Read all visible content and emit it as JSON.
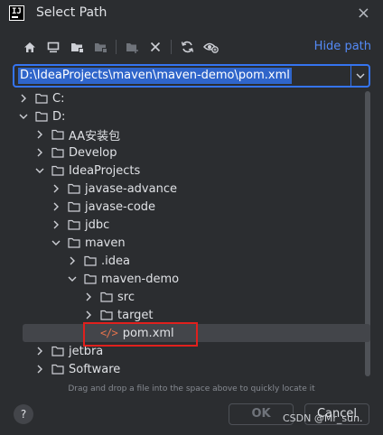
{
  "window": {
    "logo_text": "IJ",
    "title": "Select Path",
    "close_glyph": "×"
  },
  "toolbar": {
    "icons": [
      "home-icon",
      "desktop-icon",
      "project-folder-icon",
      "module-folder-icon",
      "new-folder-icon",
      "delete-icon",
      "refresh-icon",
      "show-hidden-icon"
    ],
    "hide_path_label": "Hide path"
  },
  "path": {
    "value": "D:\\IdeaProjects\\maven\\maven-demo\\pom.xml"
  },
  "tree": {
    "rows": [
      {
        "label": "C:",
        "expanded": false,
        "type": "folder"
      },
      {
        "label": "D:",
        "expanded": true,
        "type": "folder"
      },
      {
        "label": "AA安装包",
        "expanded": false,
        "type": "folder"
      },
      {
        "label": "Develop",
        "expanded": false,
        "type": "folder"
      },
      {
        "label": "IdeaProjects",
        "expanded": true,
        "type": "folder"
      },
      {
        "label": "javase-advance",
        "expanded": false,
        "type": "folder"
      },
      {
        "label": "javase-code",
        "expanded": false,
        "type": "folder"
      },
      {
        "label": "jdbc",
        "expanded": false,
        "type": "folder"
      },
      {
        "label": "maven",
        "expanded": true,
        "type": "folder"
      },
      {
        "label": ".idea",
        "expanded": false,
        "type": "folder"
      },
      {
        "label": "maven-demo",
        "expanded": true,
        "type": "folder"
      },
      {
        "label": "src",
        "expanded": false,
        "type": "folder"
      },
      {
        "label": "target",
        "expanded": false,
        "type": "folder"
      },
      {
        "label": "pom.xml",
        "type": "file",
        "selected": true,
        "icon_text": "</>"
      },
      {
        "label": "jetbra",
        "expanded": false,
        "type": "folder"
      },
      {
        "label": "Software",
        "expanded": false,
        "type": "folder"
      }
    ]
  },
  "footer": {
    "hint": "Drag and drop a file into the space above to quickly locate it",
    "help_label": "?",
    "ok_label": "OK",
    "cancel_label": "Cancel",
    "watermark": "CSDN @Mr_sun."
  },
  "colors": {
    "background": "#2b2d30",
    "accent": "#3574f0",
    "link": "#548af7",
    "selection": "#43454a",
    "highlight_box": "#e0201d",
    "xml_icon": "#e5734d"
  }
}
